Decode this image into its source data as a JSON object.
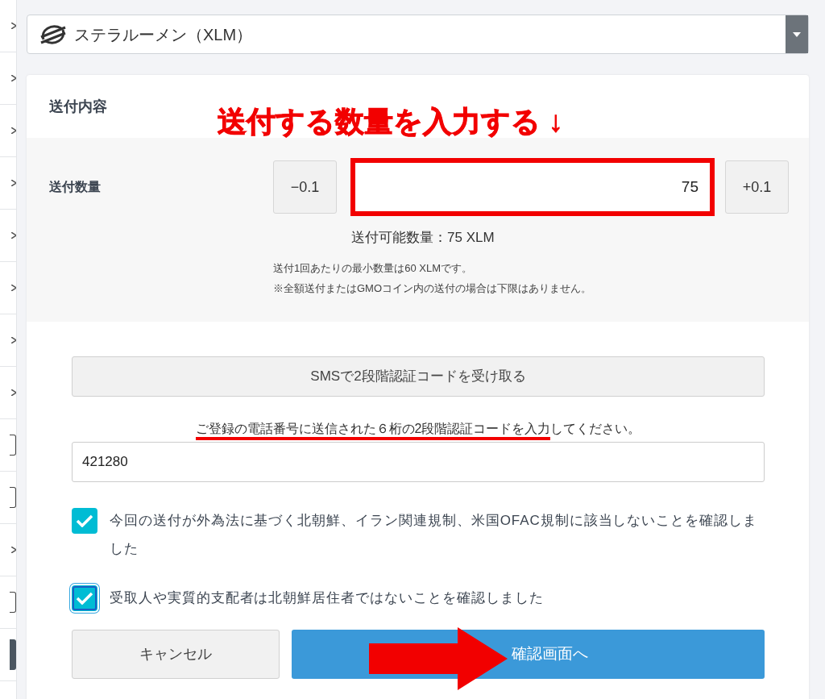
{
  "sidebar": {
    "items": [
      {
        "kind": "chevron"
      },
      {
        "kind": "chevron"
      },
      {
        "kind": "chevron"
      },
      {
        "kind": "chevron"
      },
      {
        "kind": "chevron"
      },
      {
        "kind": "chevron"
      },
      {
        "kind": "chevron"
      },
      {
        "kind": "chevron"
      },
      {
        "kind": "box"
      },
      {
        "kind": "box"
      },
      {
        "kind": "chevron"
      },
      {
        "kind": "box"
      },
      {
        "kind": "dark"
      }
    ]
  },
  "currency_select": {
    "value": "ステラルーメン（XLM）"
  },
  "card": {
    "title": "送付内容",
    "annotation_note": "送付する数量を入力する ↓",
    "amount": {
      "label": "送付数量",
      "minus_button": "−0.1",
      "value": "75",
      "plus_button": "+0.1",
      "highlighted": true,
      "available": "送付可能数量：75 XLM"
    },
    "notes": [
      "送付1回あたりの最小数量は60 XLMです。",
      "※全額送付またはGMOコイン内の送付の場合は下限はありません。"
    ],
    "sms_button": "SMSで2段階認証コードを受け取る",
    "instruction": {
      "underlined_part": "ご登録の電話番号に送信された６桁の2段階認証コードを入力",
      "rest": "してください。"
    },
    "code_value": "421280",
    "checkboxes": [
      {
        "label": "今回の送付が外為法に基づく北朝鮮、イラン関連規制、米国OFAC規制に該当しないことを確認しました",
        "checked": true,
        "focused": false
      },
      {
        "label": "受取人や実質的支配者は北朝鮮居住者ではないことを確認しました",
        "checked": true,
        "focused": true
      }
    ],
    "buttons": [
      {
        "label": "キャンセル",
        "kind": "secondary"
      },
      {
        "label": "確認画面へ",
        "kind": "primary"
      }
    ]
  }
}
